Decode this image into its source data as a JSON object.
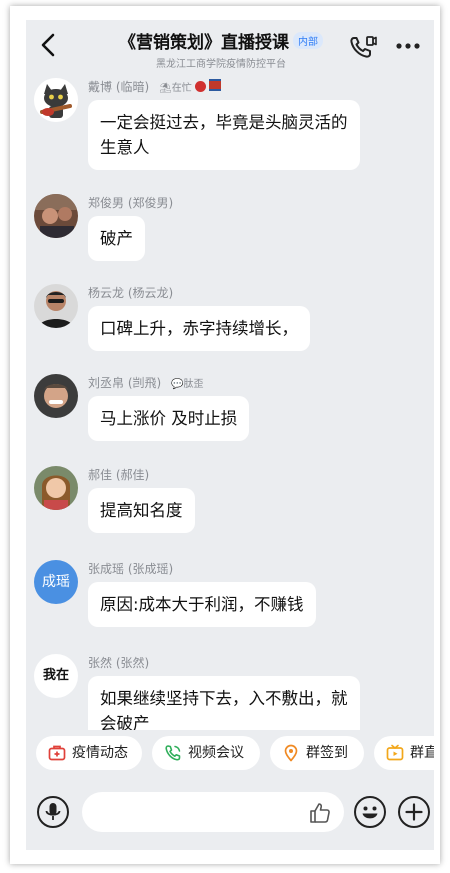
{
  "header": {
    "title": "《营销策划》直播授课",
    "badge": "内部",
    "subtitle": "黑龙江工商学院疫情防控平台"
  },
  "messages": [
    {
      "name": "戴博 (临暗)",
      "status": "在忙",
      "text": "一定会挺过去，毕竟是头脑灵活的生意人"
    },
    {
      "name": "郑俊男 (郑俊男)",
      "text": "破产"
    },
    {
      "name": "杨云龙 (杨云龙)",
      "text": "口碑上升，赤字持续增长，"
    },
    {
      "name": "刘丞帛 (剀飛)",
      "status": "肽歪",
      "text": "马上涨价 及时止损"
    },
    {
      "name": "郝佳 (郝佳)",
      "text": "提高知名度"
    },
    {
      "name": "张成瑶 (张成瑶)",
      "avatar_text": "成瑶",
      "text": "原因:成本大于利润，不赚钱"
    },
    {
      "name": "张然 (张然)",
      "avatar_text": "我在",
      "text": "如果继续坚持下去，入不敷出，就会破产"
    }
  ],
  "quick_actions": [
    {
      "label": "疫情动态",
      "icon": "medical-kit-icon"
    },
    {
      "label": "视频会议",
      "icon": "phone-call-icon"
    },
    {
      "label": "群签到",
      "icon": "location-pin-icon"
    },
    {
      "label": "群直播",
      "icon": "tv-icon"
    }
  ],
  "colors": {
    "background": "#ebedf0",
    "bubble": "#ffffff",
    "accent_blue": "#2f7df6",
    "avatar_blue": "#4a90e2"
  }
}
